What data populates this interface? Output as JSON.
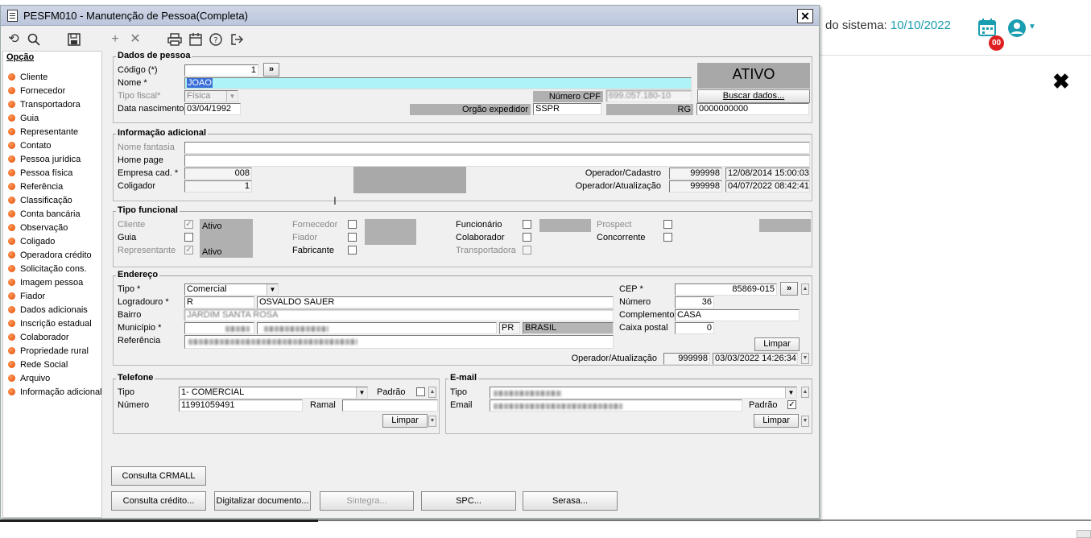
{
  "background": {
    "system_date_label": "do sistema:",
    "system_date": "10/10/2022",
    "calendar_badge": "00"
  },
  "window": {
    "title": "PESFM010 - Manutenção de Pessoa(Completa)",
    "close_label": "✕"
  },
  "toolbar": {
    "icons": [
      "refresh-icon",
      "search-icon",
      "save-icon",
      "add-icon",
      "delete-icon",
      "print-icon",
      "calendar-icon",
      "help-icon",
      "exit-icon"
    ]
  },
  "sidebar": {
    "title": "Opção",
    "items": [
      "Cliente",
      "Fornecedor",
      "Transportadora",
      "Guia",
      "Representante",
      "Contato",
      "Pessoa jurídica",
      "Pessoa física",
      "Referência",
      "Classificação",
      "Conta bancária",
      "Observação",
      "Coligado",
      "Operadora crédito",
      "Solicitação cons.",
      "Imagem pessoa",
      "Fiador",
      "Dados adicionais",
      "Inscrição estadual",
      "Colaborador",
      "Propriedade rural",
      "Rede Social",
      "Arquivo",
      "Informação adicional"
    ]
  },
  "dados": {
    "title": "Dados de pessoa",
    "codigo_label": "Código (*)",
    "codigo": "1",
    "codigo_btn": "»",
    "nome_label": "Nome *",
    "nome": "JOAO",
    "tipo_fiscal_label": "Tipo fiscal*",
    "tipo_fiscal": "Física",
    "cpf_label": "Número CPF",
    "cpf": "699.057.180-10",
    "data_nasc_label": "Data nascimento",
    "data_nasc": "03/04/1992",
    "orgao_label": "Orgão expedidor",
    "orgao": "SSPR",
    "rg_label": "RG",
    "rg": "0000000000",
    "status": "ATIVO",
    "buscar_label": "Buscar dados..."
  },
  "info": {
    "title": "Informação adicional",
    "nome_fantasia_label": "Nome fantasia",
    "home_page_label": "Home page",
    "empresa_label": "Empresa cad. *",
    "empresa": "008",
    "coligador_label": "Coligador",
    "coligador": "1",
    "op_cad_label": "Operador/Cadastro",
    "op_cad": "999998",
    "op_cad_date": "12/08/2014 15:00:03",
    "op_at_label": "Operador/Atualização",
    "op_at": "999998",
    "op_at_date": "04/07/2022 08:42:41"
  },
  "tipo": {
    "title": "Tipo funcional",
    "cliente": "Cliente",
    "guia": "Guia",
    "representante": "Representante",
    "ativo": "Ativo",
    "fornecedor": "Fornecedor",
    "fiador": "Fiador",
    "fabricante": "Fabricante",
    "funcionario": "Funcionário",
    "colaborador": "Colaborador",
    "transportadora": "Transportadora",
    "prospect": "Prospect",
    "concorrente": "Concorrente",
    "check_mark": "✓"
  },
  "endereco": {
    "title": "Endereço",
    "tipo_label": "Tipo *",
    "tipo": "Comercial",
    "logradouro_label": "Logradouro *",
    "logradouro_tipo": "R",
    "logradouro": "OSVALDO SAUER",
    "bairro_label": "Bairro",
    "bairro": "JARDIM SANTA ROSA",
    "municipio_label": "Município *",
    "uf": "PR",
    "pais": "BRASIL",
    "referencia_label": "Referência",
    "cep_label": "CEP *",
    "cep": "85869-015",
    "cep_btn": "»",
    "numero_label": "Número",
    "numero": "36",
    "complemento_label": "Complemento",
    "complemento": "CASA",
    "caixa_label": "Caixa postal",
    "caixa": "0",
    "limpar": "Limpar",
    "op_at_label": "Operador/Atualização",
    "op_at": "999998",
    "op_at_date": "03/03/2022 14:26:34"
  },
  "telefone": {
    "title": "Telefone",
    "tipo_label": "Tipo",
    "tipo": "1- COMERCIAL",
    "padrao_label": "Padrão",
    "numero_label": "Número",
    "numero": "11991059491",
    "ramal_label": "Ramal",
    "limpar": "Limpar"
  },
  "email": {
    "title": "E-mail",
    "tipo_label": "Tipo",
    "email_label": "Email",
    "padrao_label": "Padrão",
    "limpar": "Limpar"
  },
  "actions": {
    "crmall": "Consulta CRMALL",
    "credito": "Consulta crédito...",
    "digitalizar": "Digitalizar documento...",
    "sintegra": "Sintegra...",
    "spc": "SPC...",
    "serasa": "Serasa..."
  }
}
